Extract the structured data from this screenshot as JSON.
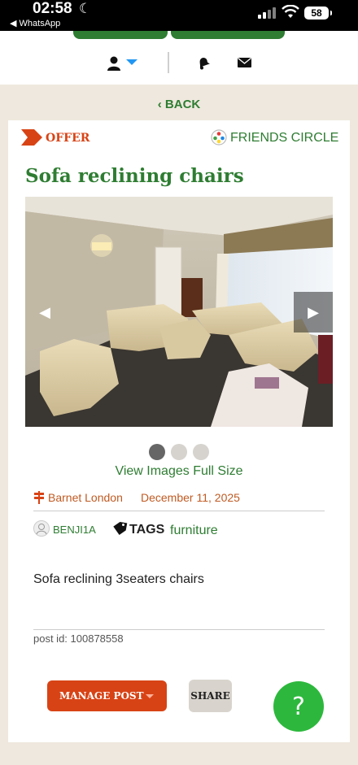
{
  "status_bar": {
    "time": "02:58",
    "back_app": "◀ WhatsApp",
    "battery": "58"
  },
  "nav": {
    "back_label": "‹ BACK"
  },
  "post": {
    "type_label": "OFFER",
    "visibility": "FRIENDS CIRCLE",
    "title": "Sofa reclining chairs",
    "gallery": {
      "image_count": 3,
      "current_index": 1
    },
    "view_full_label": "View Images Full Size",
    "location": "Barnet London",
    "date": "December 11, 2025",
    "username": "BENJI1A",
    "tags_label": "TAGS",
    "tags": [
      "furniture"
    ],
    "description": "Sofa reclining 3seaters chairs",
    "post_id_text": "post id: 100878558"
  },
  "actions": {
    "manage_label": "MANAGE POST",
    "share_label": "SHARE",
    "help_label": "?"
  },
  "colors": {
    "brand_green": "#2e7d32",
    "offer_orange": "#d84315",
    "help_green": "#2db83d",
    "page_bg": "#efe8de"
  }
}
